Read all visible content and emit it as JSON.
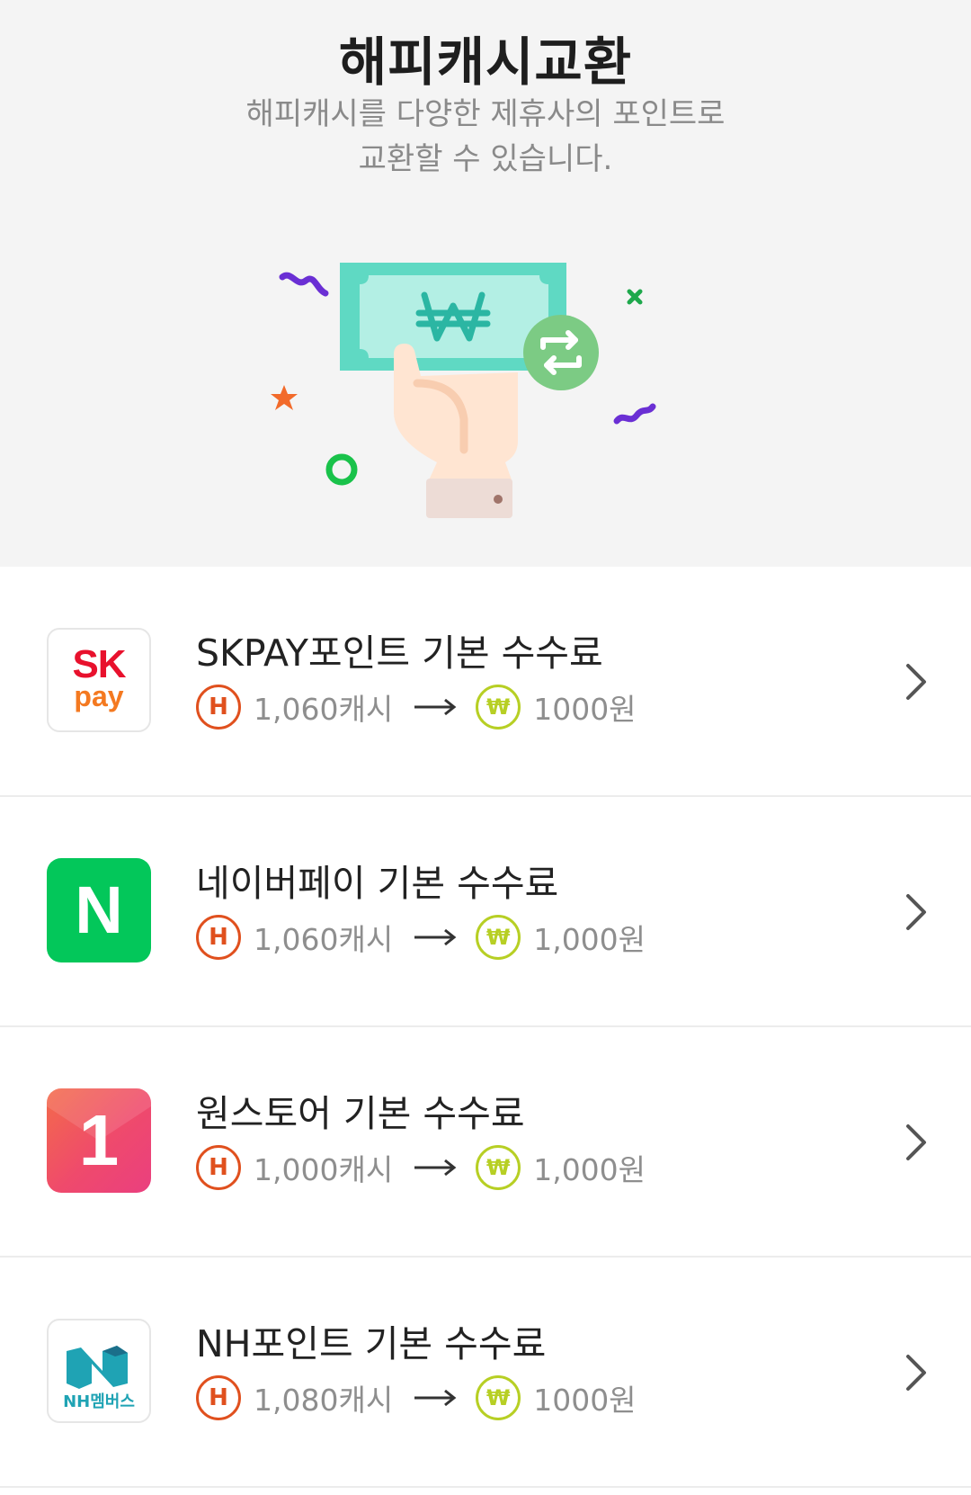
{
  "header": {
    "title": "해피캐시교환",
    "desc_line1": "해피캐시를 다양한 제휴사의 포인트로",
    "desc_line2": "교환할 수 있습니다."
  },
  "icons": {
    "hero": "cash-exchange-illustration",
    "cash_coin": "happycash-h-icon",
    "won_coin": "won-coin-icon",
    "arrow": "arrow-right-icon",
    "chevron": "chevron-right-icon"
  },
  "colors": {
    "cash_coin": "#e0501e",
    "won_coin": "#b7cf24",
    "naver_green": "#03c75a",
    "onestore_pink": "#ef4a6c",
    "sk_red": "#e8112d",
    "sk_orange": "#f47920",
    "nh_teal": "#1fa3b4"
  },
  "coin_labels": {
    "cash": "H",
    "won": "₩"
  },
  "exchanges": [
    {
      "title": "SKPAY포인트 기본 수수료",
      "cash_amount": "1,060캐시",
      "won_amount": "1000원",
      "logo": {
        "line1": "SK",
        "line2": "pay"
      }
    },
    {
      "title": "네이버페이 기본 수수료",
      "cash_amount": "1,060캐시",
      "won_amount": "1,000원",
      "logo": {
        "letter": "N"
      }
    },
    {
      "title": "원스토어 기본 수수료",
      "cash_amount": "1,000캐시",
      "won_amount": "1,000원",
      "logo": {
        "letter": "1"
      }
    },
    {
      "title": "NH포인트 기본 수수료",
      "cash_amount": "1,080캐시",
      "won_amount": "1000원",
      "logo": {
        "label": "NH멤버스"
      }
    }
  ]
}
